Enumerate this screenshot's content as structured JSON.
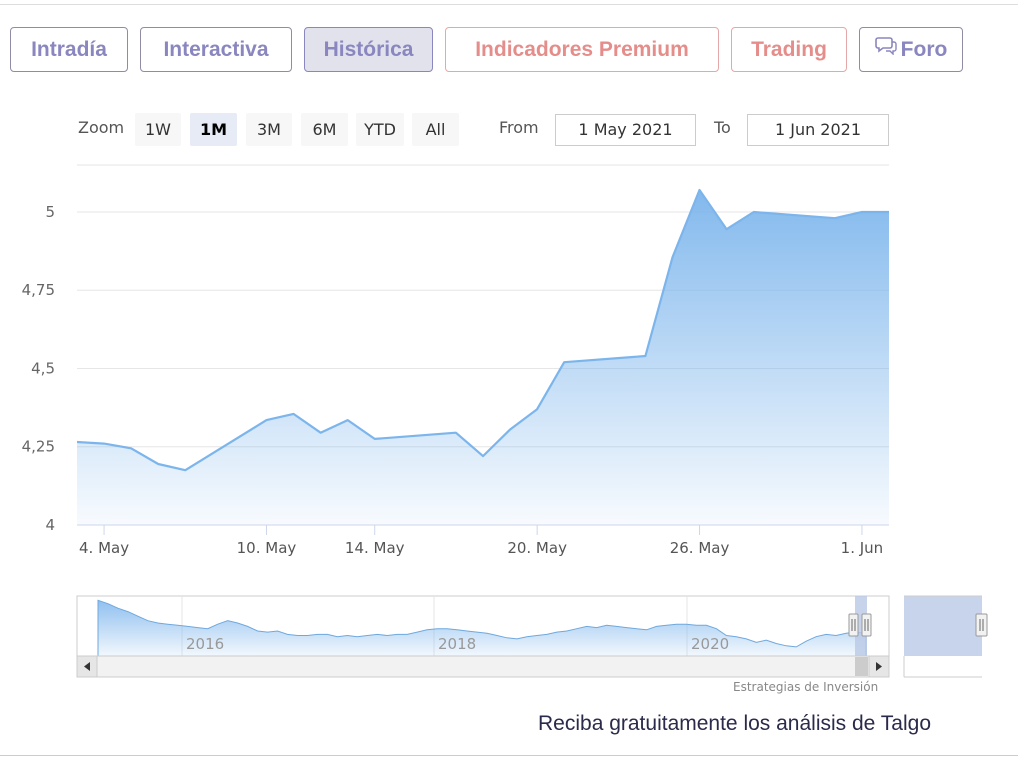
{
  "tabs": [
    {
      "label": "Intradía",
      "style": "violet",
      "active": false
    },
    {
      "label": "Interactiva",
      "style": "violet",
      "active": false
    },
    {
      "label": "Histórica",
      "style": "violet",
      "active": true
    },
    {
      "label": "Indicadores Premium",
      "style": "salmon",
      "active": false
    },
    {
      "label": "Trading",
      "style": "salmon",
      "active": false
    },
    {
      "label": "Foro",
      "style": "violet",
      "active": false,
      "icon": "chat-bubble-icon"
    }
  ],
  "zoom": {
    "label": "Zoom",
    "buttons": [
      "1W",
      "1M",
      "3M",
      "6M",
      "YTD",
      "All"
    ],
    "selected": "1M"
  },
  "range": {
    "from_label": "From",
    "from_value": "1 May 2021",
    "to_label": "To",
    "to_value": "1 Jun 2021"
  },
  "chart_data": {
    "type": "area",
    "x": [
      "2021-05-03",
      "2021-05-04",
      "2021-05-05",
      "2021-05-06",
      "2021-05-07",
      "2021-05-10",
      "2021-05-11",
      "2021-05-12",
      "2021-05-13",
      "2021-05-14",
      "2021-05-17",
      "2021-05-18",
      "2021-05-19",
      "2021-05-20",
      "2021-05-21",
      "2021-05-24",
      "2021-05-25",
      "2021-05-26",
      "2021-05-27",
      "2021-05-28",
      "2021-05-31",
      "2021-06-01",
      "2021-06-02"
    ],
    "values": [
      4.265,
      4.26,
      4.245,
      4.195,
      4.175,
      4.335,
      4.355,
      4.295,
      4.335,
      4.275,
      4.295,
      4.22,
      4.305,
      4.37,
      4.52,
      4.54,
      4.855,
      5.07,
      4.945,
      5.0,
      4.98,
      5.0,
      5.0
    ],
    "ylim": [
      4,
      5.15
    ],
    "yticks": [
      "4",
      "4,25",
      "4,5",
      "4,75",
      "5"
    ],
    "ytick_values": [
      4,
      4.25,
      4.5,
      4.75,
      5
    ],
    "xticks": [
      {
        "label": "4. May",
        "date": "2021-05-04"
      },
      {
        "label": "10. May",
        "date": "2021-05-10"
      },
      {
        "label": "14. May",
        "date": "2021-05-14"
      },
      {
        "label": "20. May",
        "date": "2021-05-20"
      },
      {
        "label": "26. May",
        "date": "2021-05-26"
      },
      {
        "label": "1. Jun",
        "date": "2021-06-01"
      }
    ],
    "grid": true,
    "line_color": "#7cb5ec",
    "fill_color_top": "#7cb5ec",
    "navigator": {
      "year_labels": [
        "2016",
        "2018",
        "2020"
      ],
      "series": [
        8.4,
        8.1,
        7.7,
        7.4,
        7.0,
        6.6,
        6.4,
        6.3,
        6.2,
        6.1,
        6.0,
        5.9,
        6.3,
        6.6,
        6.4,
        6.1,
        5.7,
        5.6,
        5.7,
        5.4,
        5.3,
        5.3,
        5.4,
        5.4,
        5.2,
        5.3,
        5.2,
        5.3,
        5.4,
        5.3,
        5.4,
        5.4,
        5.6,
        5.8,
        5.9,
        5.9,
        5.8,
        5.7,
        5.6,
        5.5,
        5.3,
        5.1,
        5.0,
        5.2,
        5.3,
        5.4,
        5.6,
        5.7,
        5.9,
        6.1,
        6.0,
        6.2,
        6.1,
        6.0,
        5.9,
        5.8,
        6.1,
        6.2,
        6.3,
        6.3,
        6.2,
        6.2,
        5.9,
        5.3,
        5.2,
        5.0,
        4.7,
        4.9,
        4.6,
        4.4,
        4.3,
        4.8,
        5.2,
        5.4,
        5.3,
        5.5,
        5.6,
        5.5
      ]
    }
  },
  "credits": "Estrategias de Inversión",
  "subscribe": "Reciba gratuitamente los análisis de Talgo"
}
